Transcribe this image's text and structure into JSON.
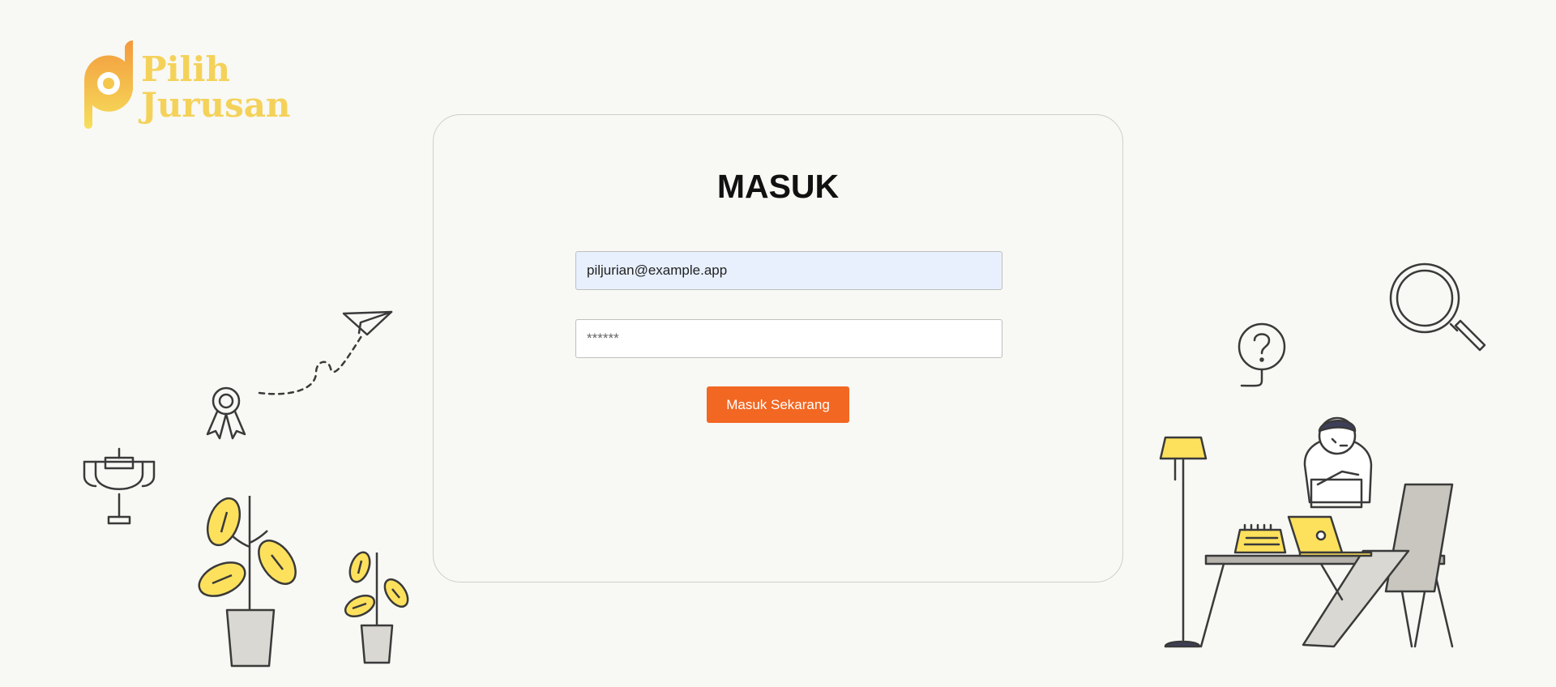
{
  "brand": {
    "line1": "Pilih",
    "line2": "Jurusan"
  },
  "form": {
    "title": "MASUK",
    "email_value": "piljurian@example.app",
    "password_placeholder": "******",
    "submit_label": "Masuk Sekarang"
  },
  "colors": {
    "background": "#f8f8f4",
    "accent": "#f26722",
    "logo": "#f4d25a",
    "email_fill": "#e8f0fe",
    "illustration_yellow": "#fde15d",
    "illustration_stroke": "#3a3a3a"
  }
}
